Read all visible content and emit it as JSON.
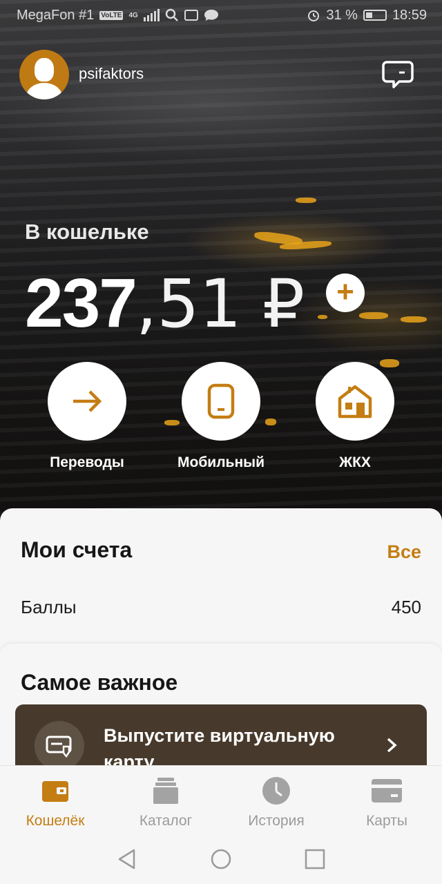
{
  "status_bar": {
    "carrier": "MegaFon #1",
    "volte": "VoLTE",
    "network": "4G",
    "battery_percent": "31 %",
    "time": "18:59"
  },
  "header": {
    "username": "psifaktors",
    "avatar_icon": "user-avatar-icon",
    "chat_icon": "chat-bubble-icon"
  },
  "wallet": {
    "label": "В кошельке",
    "amount_integer": "237",
    "amount_fraction": ",51 ₽",
    "add_icon": "plus-icon"
  },
  "quick_actions": [
    {
      "label": "Переводы",
      "icon": "arrow-right-icon"
    },
    {
      "label": "Мобильный",
      "icon": "mobile-phone-icon"
    },
    {
      "label": "ЖКХ",
      "icon": "house-icon"
    }
  ],
  "accounts": {
    "title": "Мои счета",
    "all_link": "Все",
    "rows": [
      {
        "label": "Баллы",
        "value": "450"
      }
    ]
  },
  "important": {
    "title": "Самое важное",
    "promo_text": "Выпустите виртуальную карту"
  },
  "bottom_nav": [
    {
      "label": "Кошелёк",
      "icon": "wallet-icon",
      "active": true
    },
    {
      "label": "Каталог",
      "icon": "catalog-icon",
      "active": false
    },
    {
      "label": "История",
      "icon": "clock-icon",
      "active": false
    },
    {
      "label": "Карты",
      "icon": "card-icon",
      "active": false
    }
  ],
  "colors": {
    "accent": "#c47d12",
    "promo_bg": "#473a2c",
    "sheet_bg": "#f6f6f6"
  }
}
